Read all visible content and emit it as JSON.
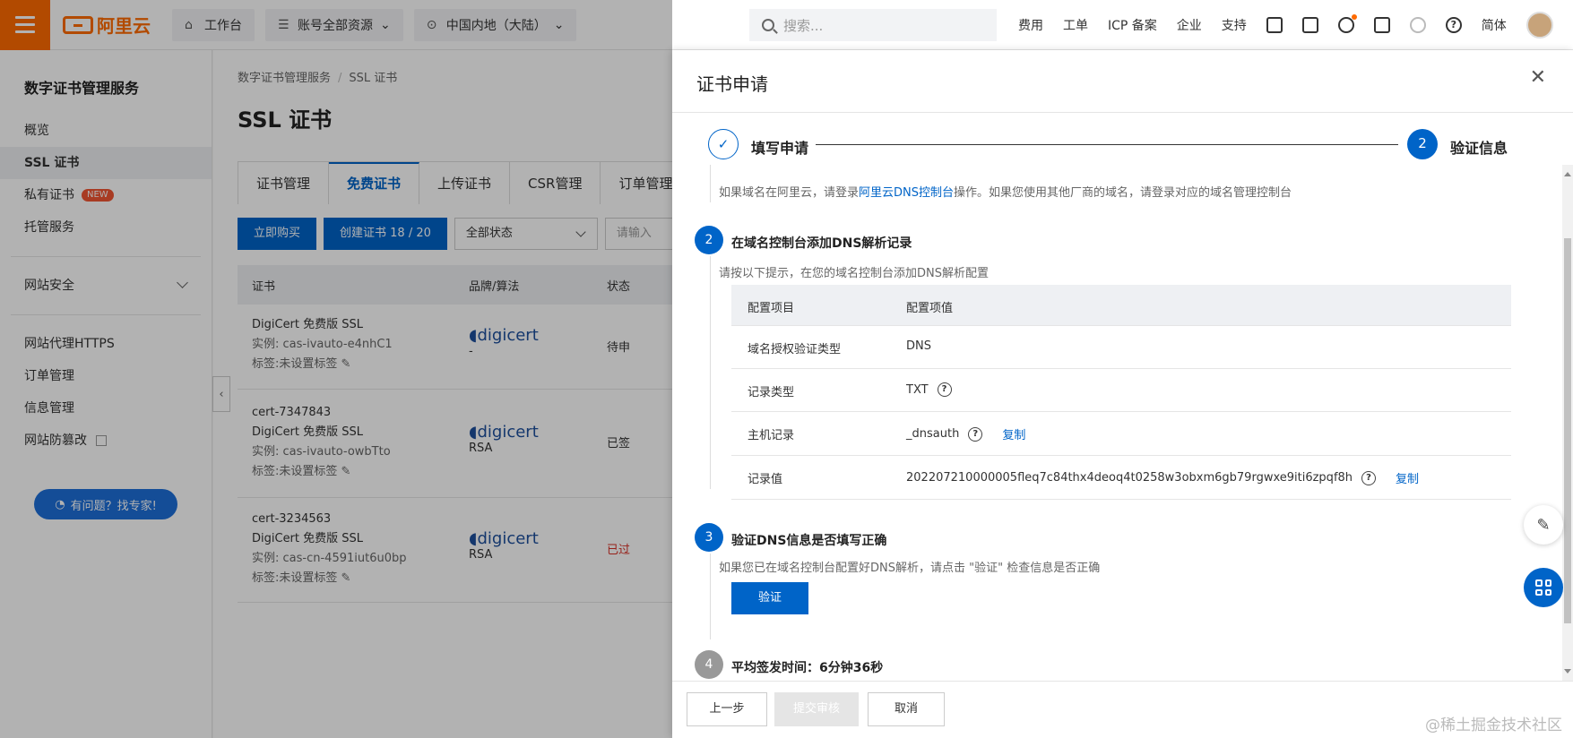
{
  "topbar": {
    "logo_text": "阿里云",
    "workbench": "工作台",
    "resources": "账号全部资源",
    "region": "中国内地（大陆）",
    "search_placeholder": "搜索...",
    "links": [
      "费用",
      "工单",
      "ICP 备案",
      "企业",
      "支持"
    ],
    "lang": "简体"
  },
  "sidebar": {
    "title": "数字证书管理服务",
    "items": [
      "概览",
      "SSL 证书",
      "私有证书",
      "托管服务"
    ],
    "new_badge": "NEW",
    "site_security": "网站安全",
    "items2": [
      "网站代理HTTPS",
      "订单管理",
      "信息管理",
      "网站防篡改"
    ],
    "expert_btn": "有问题？找专家!"
  },
  "main": {
    "breadcrumb": [
      "数字证书管理服务",
      "SSL 证书"
    ],
    "title": "SSL 证书",
    "tabs": [
      "证书管理",
      "免费证书",
      "上传证书",
      "CSR管理",
      "订单管理"
    ],
    "buy_btn": "立即购买",
    "create_btn": "创建证书 18 / 20",
    "status_select": "全部状态",
    "search_input": "请输入",
    "columns": [
      "证书",
      "品牌/算法",
      "状态"
    ],
    "rows": [
      {
        "name": "DigiCert 免费版 SSL",
        "instance": "实例: cas-ivauto-e4nhC1",
        "tag": "标签:未设置标签",
        "brand": "digicert",
        "algo": "-",
        "status": "待申"
      },
      {
        "id": "cert-7347843",
        "name": "DigiCert 免费版 SSL",
        "instance": "实例: cas-ivauto-owbTto",
        "tag": "标签:未设置标签",
        "brand": "digicert",
        "algo": "RSA",
        "status": "已签"
      },
      {
        "id": "cert-3234563",
        "name": "DigiCert 免费版 SSL",
        "instance": "实例: cas-cn-4591iut6u0bp",
        "tag": "标签:未设置标签",
        "brand": "digicert",
        "algo": "RSA",
        "status": "已过"
      }
    ]
  },
  "drawer": {
    "title": "证书申请",
    "step1": "填写申请",
    "step2": "验证信息",
    "step2_num": "2",
    "hint_top_pre": "如果域名在阿里云，请登录",
    "hint_top_link": "阿里云DNS控制台",
    "hint_top_post": "操作。如果您使用其他厂商的域名，请登录对应的域名管理控制台",
    "sec2_num": "2",
    "sec2_title": "在域名控制台添加DNS解析记录",
    "sec2_hint": "请按以下提示，在您的域名控制台添加DNS解析配置",
    "table_head": [
      "配置项目",
      "配置项值"
    ],
    "table_rows": [
      {
        "k": "域名授权验证类型",
        "v": "DNS"
      },
      {
        "k": "记录类型",
        "v": "TXT"
      },
      {
        "k": "主机记录",
        "v": "_dnsauth"
      },
      {
        "k": "记录值",
        "v": "202207210000005fleq7c84thx4deoq4t0258w3obxm6gb79rgwxe9iti6zpqf8h"
      }
    ],
    "copy": "复制",
    "sec3_num": "3",
    "sec3_title": "验证DNS信息是否填写正确",
    "sec3_hint": "如果您已在域名控制台配置好DNS解析，请点击 \"验证\" 检查信息是否正确",
    "verify_btn": "验证",
    "sec4_num": "4",
    "sec4_title": "平均签发时间：6分钟36秒",
    "prev_btn": "上一步",
    "submit_btn": "提交审核",
    "cancel_btn": "取消"
  },
  "watermark": "@稀土掘金技术社区"
}
